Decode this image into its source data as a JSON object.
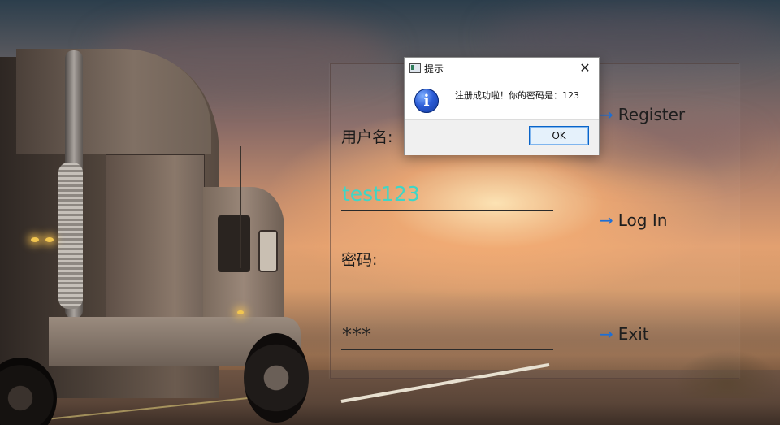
{
  "login": {
    "username_label": "用户名:",
    "username_value": "test123",
    "password_label": "密码:",
    "password_value": "***",
    "register_label": "Register",
    "login_label": "Log In",
    "exit_label": "Exit"
  },
  "dialog": {
    "title": "提示",
    "message": "注册成功啦！你的密码是：123",
    "ok_label": "OK",
    "close_symbol": "✕",
    "info_symbol": "i"
  },
  "icons": {
    "action_arrow": "→",
    "dialog_icon": "info-icon"
  },
  "colors": {
    "arrow": "#1d6fd6",
    "username_text": "#3fd6c6",
    "password_text": "#222222"
  }
}
